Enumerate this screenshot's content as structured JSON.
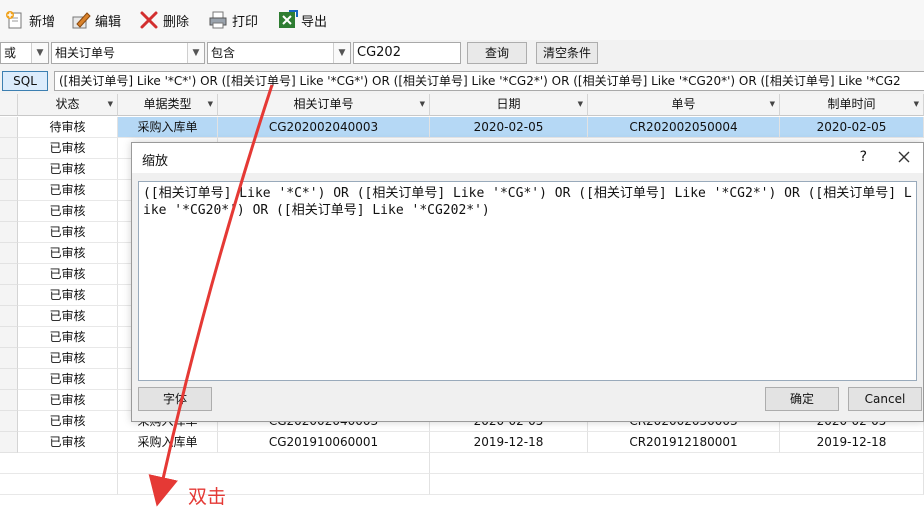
{
  "toolbar": {
    "add_label": "新增",
    "edit_label": "编辑",
    "delete_label": "删除",
    "print_label": "打印",
    "export_label": "导出"
  },
  "filter": {
    "logic_value": "或",
    "field_value": "相关订单号",
    "operator_value": "包含",
    "search_value": "CG202",
    "query_label": "查询",
    "clear_label": "清空条件"
  },
  "sql": {
    "button_label": "SQL",
    "text": "([相关订单号] Like '*C*') OR ([相关订单号] Like '*CG*') OR ([相关订单号] Like '*CG2*') OR ([相关订单号] Like '*CG20*') OR ([相关订单号] Like '*CG2"
  },
  "grid": {
    "columns": [
      "状态",
      "单据类型",
      "相关订单号",
      "日期",
      "单号",
      "制单时间"
    ],
    "selected_row": {
      "status": "待审核",
      "type": "采购入库单",
      "order_no": "CG202002040003",
      "date": "2020-02-05",
      "doc_no": "CR202002050004",
      "created": "2020-02-05"
    },
    "status_rows": [
      "已审核",
      "已审核",
      "已审核",
      "已审核",
      "已审核",
      "已审核",
      "已审核",
      "已审核",
      "已审核",
      "已审核",
      "已审核",
      "已审核",
      "已审核"
    ],
    "partial_row": {
      "status": "已审核",
      "type": "采购入库单",
      "order_no": "CG202002040003",
      "date": "2020-02-05",
      "doc_no": "CR202002050003",
      "created": "2020-02-05"
    },
    "last_row": {
      "status": "已审核",
      "type": "采购入库单",
      "order_no": "CG201910060001",
      "date": "2019-12-18",
      "doc_no": "CR201912180001",
      "created": "2019-12-18"
    }
  },
  "dialog": {
    "title": "缩放",
    "help_label": "?",
    "text": "([相关订单号] Like '*C*') OR ([相关订单号] Like '*CG*') OR ([相关订单号] Like '*CG2*') OR ([相关订单号] Like '*CG20*') OR ([相关订单号] Like '*CG202*')",
    "font_label": "字体",
    "ok_label": "确定",
    "cancel_label": "Cancel"
  },
  "annotation": {
    "text": "双击",
    "color": "#e53935"
  }
}
